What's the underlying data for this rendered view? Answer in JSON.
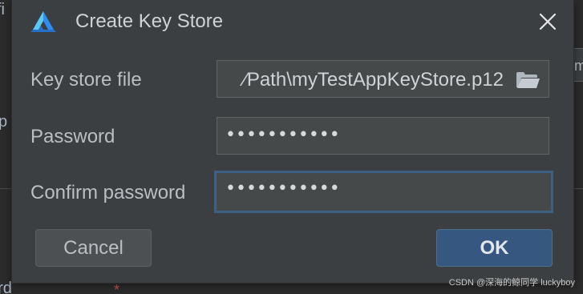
{
  "dialog": {
    "title": "Create Key Store"
  },
  "fields": {
    "key_store_file": {
      "label": "Key store file",
      "value": "⁄Path\\myTestAppKeyStore.p12"
    },
    "password": {
      "label": "Password",
      "value": "•••••••••••"
    },
    "confirm_password": {
      "label": "Confirm password",
      "value": "•••••••••••"
    }
  },
  "buttons": {
    "cancel": "Cancel",
    "ok": "OK"
  },
  "background": {
    "left_top_fragment": "fi",
    "left_mid_fragment": "p",
    "left_bottom_fragment": "ord",
    "required_marker": "*",
    "right_fragment": "m"
  },
  "watermark": "CSDN @深海的鲸同学 luckyboy",
  "icons": {
    "app_logo": "app-logo-icon",
    "close": "close-icon",
    "folder": "folder-open-icon"
  },
  "colors": {
    "dialog_bg": "#3c3f41",
    "field_bg": "#45494a",
    "focus_border": "#3d6185",
    "ok_button": "#365880",
    "logo_blue": "#2f8cf0",
    "logo_light": "#5cc8f5"
  }
}
